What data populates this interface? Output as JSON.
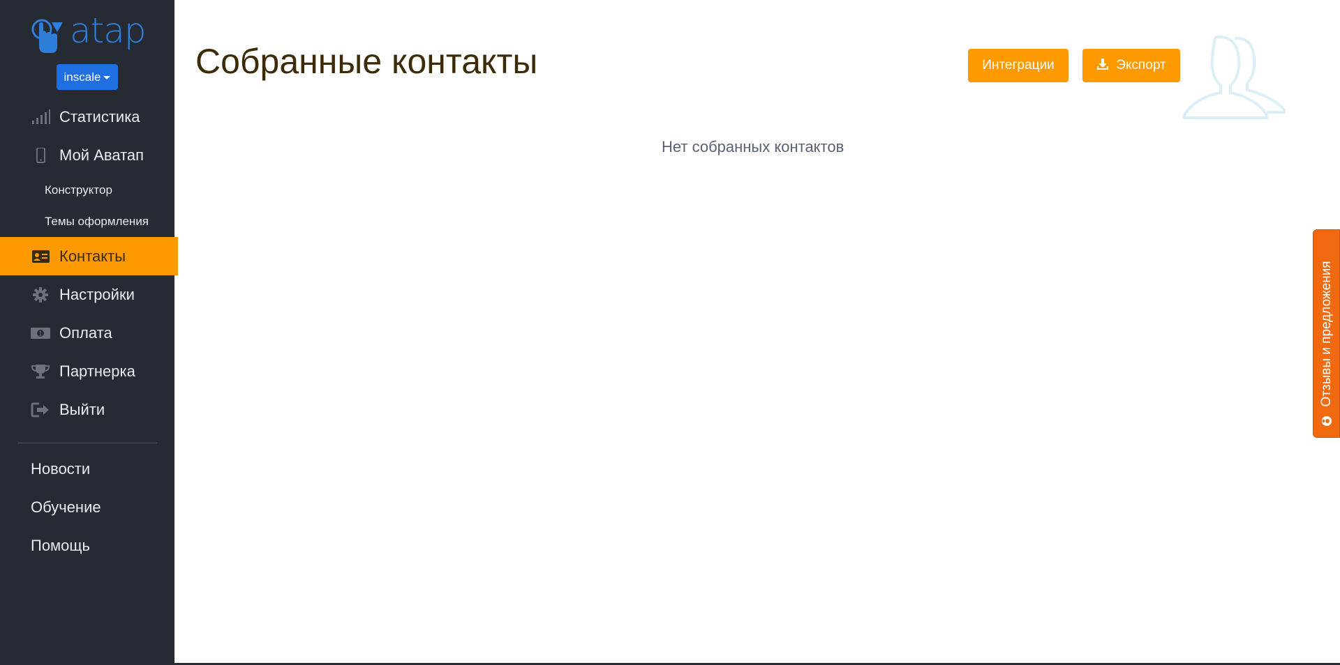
{
  "brand": {
    "logo_text": "avatap",
    "accent_color": "#2e7fd9"
  },
  "account": {
    "name": "inscale"
  },
  "nav": {
    "items": [
      {
        "label": "Статистика",
        "icon": "signal-bars-icon"
      },
      {
        "label": "Мой Аватап",
        "icon": "mobile-phone-icon"
      },
      {
        "label": "Контакты",
        "icon": "id-card-icon",
        "active": true
      },
      {
        "label": "Настройки",
        "icon": "gear-icon"
      },
      {
        "label": "Оплата",
        "icon": "money-icon"
      },
      {
        "label": "Партнерка",
        "icon": "trophy-icon"
      },
      {
        "label": "Выйти",
        "icon": "sign-out-icon"
      }
    ],
    "sub_items": [
      "Конструктор",
      "Темы оформления"
    ],
    "secondary": [
      "Новости",
      "Обучение",
      "Помощь"
    ]
  },
  "main": {
    "title": "Собранные контакты",
    "integrations_label": "Интеграции",
    "export_label": "Экспорт",
    "empty_message": "Нет собранных контактов"
  },
  "feedback": {
    "label": "Отзывы и предложения"
  },
  "colors": {
    "sidebar_bg": "#262b33",
    "active_orange": "#ff9900",
    "feedback_orange": "#f26a0f",
    "title_brown": "#3d2a07"
  }
}
